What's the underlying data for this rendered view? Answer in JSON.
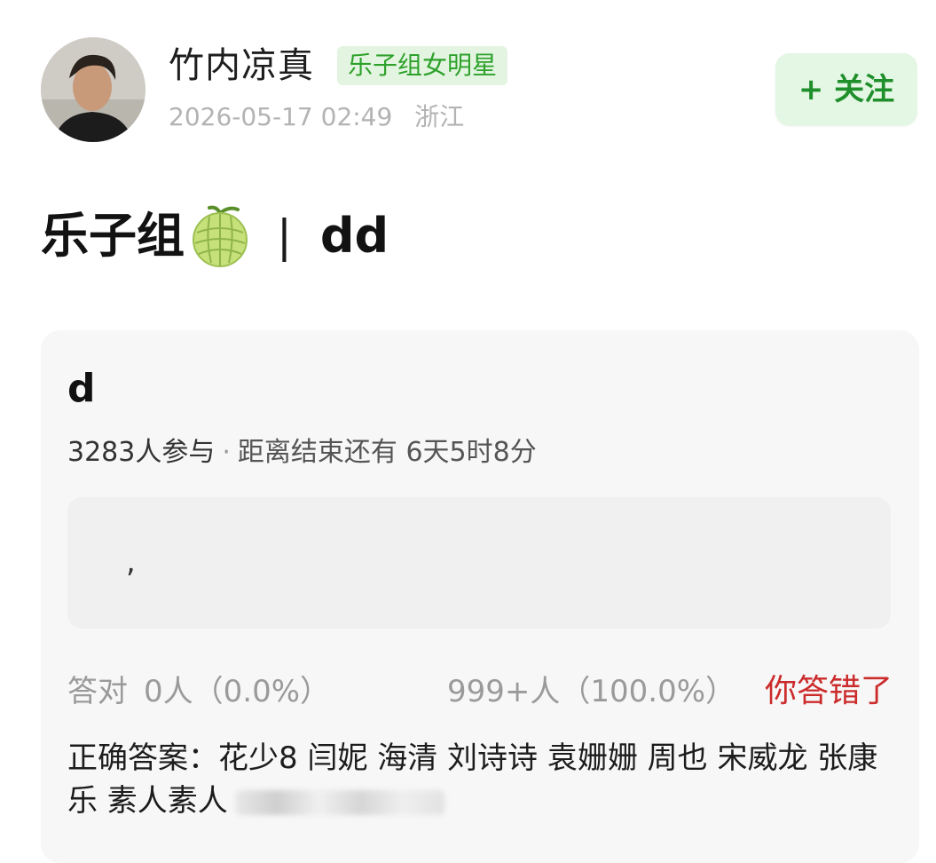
{
  "header": {
    "username": "竹内凉真",
    "badge": "乐子组女明星",
    "timestamp": "2026-05-17 02:49",
    "location": "浙江",
    "follow_label": "+ 关注",
    "avatar_icon": "user-avatar-photo"
  },
  "post": {
    "title_left": "乐子组",
    "title_icon": "melon-emoji",
    "title_separator": "|",
    "title_right": "dd"
  },
  "quiz": {
    "question": "d",
    "participants": "3283人参与",
    "separator": "·",
    "remaining": "距离结束还有 6天5时8分",
    "user_answer": ",",
    "correct_label": "答对",
    "correct_count": "0人（0.0%）",
    "wrong_count": "999+人（100.0%）",
    "result_label": "你答错了",
    "answer_text": "正确答案：花少8 闫妮 海清 刘诗诗 袁姗姗 周也 宋威龙 张康乐 素人素人"
  },
  "colors": {
    "badge_bg": "#e3f5e1",
    "badge_text": "#2ea12b",
    "follow_bg": "#e4f6e4",
    "follow_text": "#1f8f2b",
    "wrong_red": "#cc2b2b"
  }
}
